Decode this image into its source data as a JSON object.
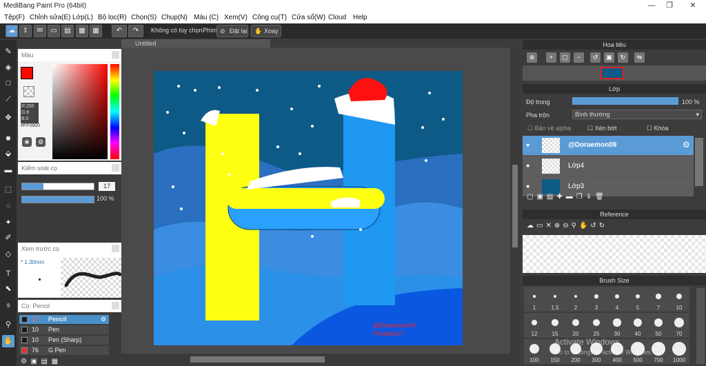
{
  "window": {
    "title": "MediBang Paint Pro (64bit)",
    "minimize": "—",
    "maximize": "❐",
    "close": "✕"
  },
  "menu": [
    "Tệp(F)",
    "Chỉnh sửa(E)",
    "Lớp(L)",
    "Bộ lọc(R)",
    "Chọn(S)",
    "Chụp(N)",
    "Màu (C)",
    "Xem(V)",
    "Công cụ(T)",
    "Cửa sổ(W)",
    "Cloud",
    "Help"
  ],
  "toolbar": {
    "no_option": "Không có tùy chọn",
    "key_label": "Phím",
    "reset": "Đặt lại",
    "rotate": "Xoay"
  },
  "document": {
    "tab": "Untitled"
  },
  "color_panel": {
    "title": "Màu",
    "r": "R:255",
    "g": "G:8",
    "b": "B:0",
    "hex": "#FF0800"
  },
  "brush_control": {
    "title": "Kiểm soát cọ",
    "size": "17",
    "opacity": "100 %",
    "size_fill": 0.3,
    "opacity_fill": 1.0
  },
  "brush_preview": {
    "title": "Xem trước cọ",
    "size": "1.30mm"
  },
  "brush_list": {
    "title": "Cọ: Pencil",
    "items": [
      {
        "size": "17",
        "name": "Pencil",
        "selected": true,
        "color": "#1a1a1a"
      },
      {
        "size": "10",
        "name": "Pen",
        "selected": false,
        "color": "#1a1a1a"
      },
      {
        "size": "10",
        "name": "Pen (Sharp)",
        "selected": false,
        "color": "#1a1a1a"
      },
      {
        "size": "76",
        "name": "G Pen",
        "selected": false,
        "color": "#e03030"
      }
    ]
  },
  "navigator": {
    "title": "Hoa tiêu"
  },
  "layer_panel": {
    "title": "Lớp",
    "opacity_label": "Độ trong",
    "opacity_value": "100 %",
    "blend_label": "Pha trộn",
    "blend_value": "Bình thường",
    "protect_alpha": "Bảo vệ alpha",
    "clipping": "Xén bớt",
    "lock": "Khóa",
    "layers": [
      {
        "name": "@Doraemon09",
        "selected": true
      },
      {
        "name": "Lớp4",
        "selected": false
      },
      {
        "name": "Lớp3",
        "selected": false
      }
    ]
  },
  "reference": {
    "title": "Reference"
  },
  "brush_size": {
    "title": "Brush Size",
    "sizes": [
      "1",
      "1.5",
      "2",
      "3",
      "4",
      "5",
      "7",
      "10",
      "12",
      "15",
      "20",
      "25",
      "30",
      "40",
      "50",
      "70",
      "100",
      "150",
      "200",
      "300",
      "400",
      "500",
      "700",
      "1000"
    ]
  },
  "artwork": {
    "signature_line1": "@Doraemon09",
    "signature_line2": "Pirulana4.7"
  },
  "watermark": {
    "line1": "Activate Windows",
    "line2": "Go to Settings to activate Windows."
  },
  "colors": {
    "accent": "#5b9bd5",
    "primary_color": "#ff0800",
    "selection": "#4a90c8"
  }
}
